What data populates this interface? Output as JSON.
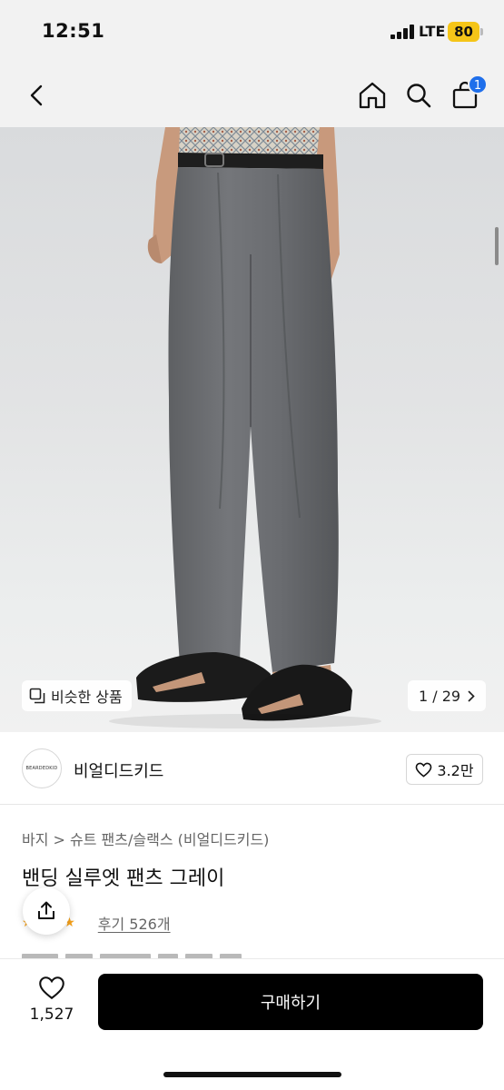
{
  "status_bar": {
    "time": "12:51",
    "network": "LTE",
    "battery": "80"
  },
  "nav": {
    "cart_count": "1",
    "icons": [
      "back-arrow-icon",
      "home-icon",
      "search-icon",
      "shopping-bag-icon"
    ]
  },
  "gallery": {
    "similar_label": "비슷한 상품",
    "counter": "1 / 29"
  },
  "brand": {
    "logo_text": "BEARDEDKID",
    "name": "비얼디드키드",
    "likes": "3.2만"
  },
  "product": {
    "breadcrumb": "바지 > 슈트 팬츠/슬랙스 (비얼디드키드)",
    "title": "밴딩 실루엣 팬츠 그레이",
    "stars": "★★★★★",
    "review_link": "후기 526개"
  },
  "bottom": {
    "wish_count": "1,527",
    "buy_label": "구매하기"
  },
  "colors": {
    "accent": "#1f6feb",
    "buy_button": "#000000",
    "battery": "#f5c518",
    "star": "#f7a21b"
  }
}
